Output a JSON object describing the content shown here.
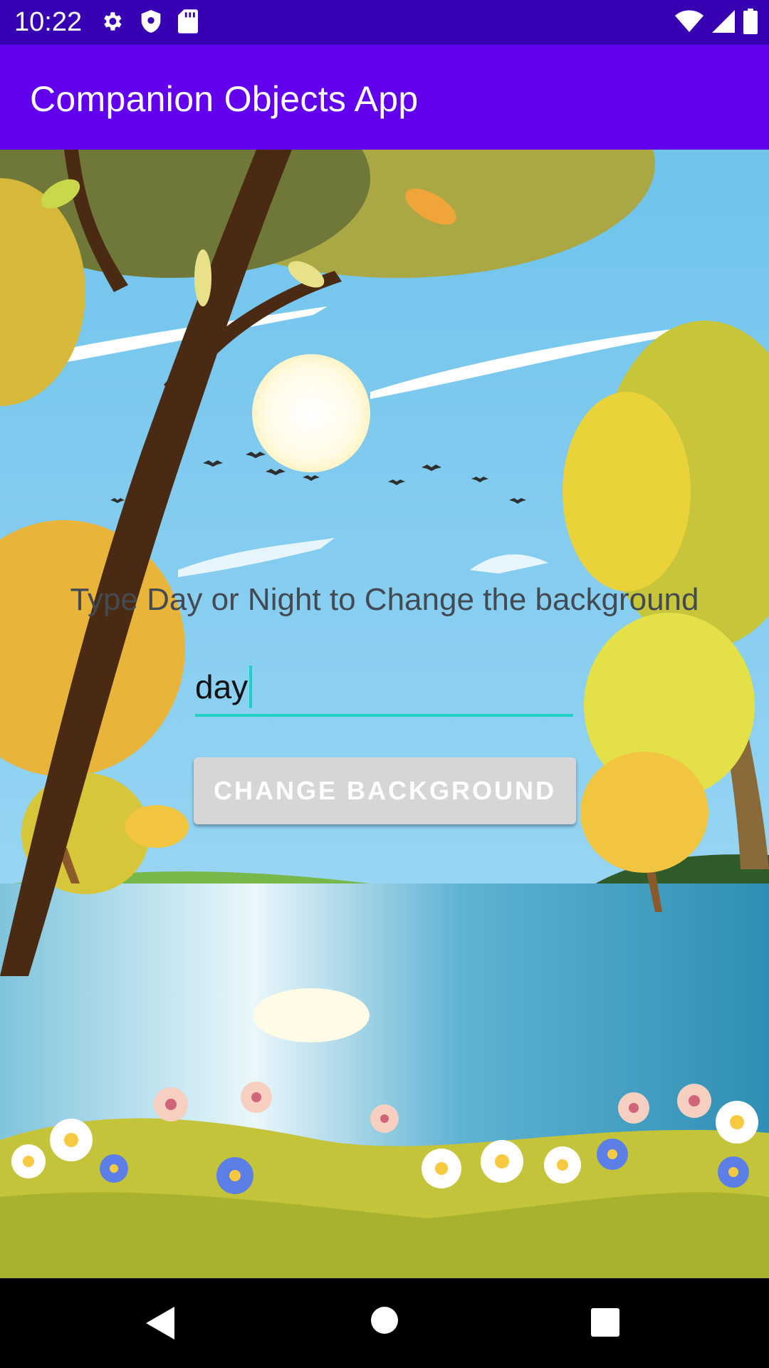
{
  "status_bar": {
    "time": "10:22",
    "left_icons": [
      "settings-icon",
      "shield-icon",
      "sd-card-icon"
    ],
    "right_icons": [
      "wifi-icon",
      "cellular-signal-icon",
      "battery-icon"
    ]
  },
  "app_bar": {
    "title": "Companion Objects App",
    "color": "#6200ee"
  },
  "main": {
    "background": "day-landscape",
    "prompt": "Type Day or Night to Change the background",
    "input_value": "day",
    "button_label": "CHANGE BACKGROUND",
    "accent_color": "#1fd1c4"
  },
  "nav_bar": {
    "buttons": [
      "back-icon",
      "home-icon",
      "recents-icon"
    ]
  }
}
